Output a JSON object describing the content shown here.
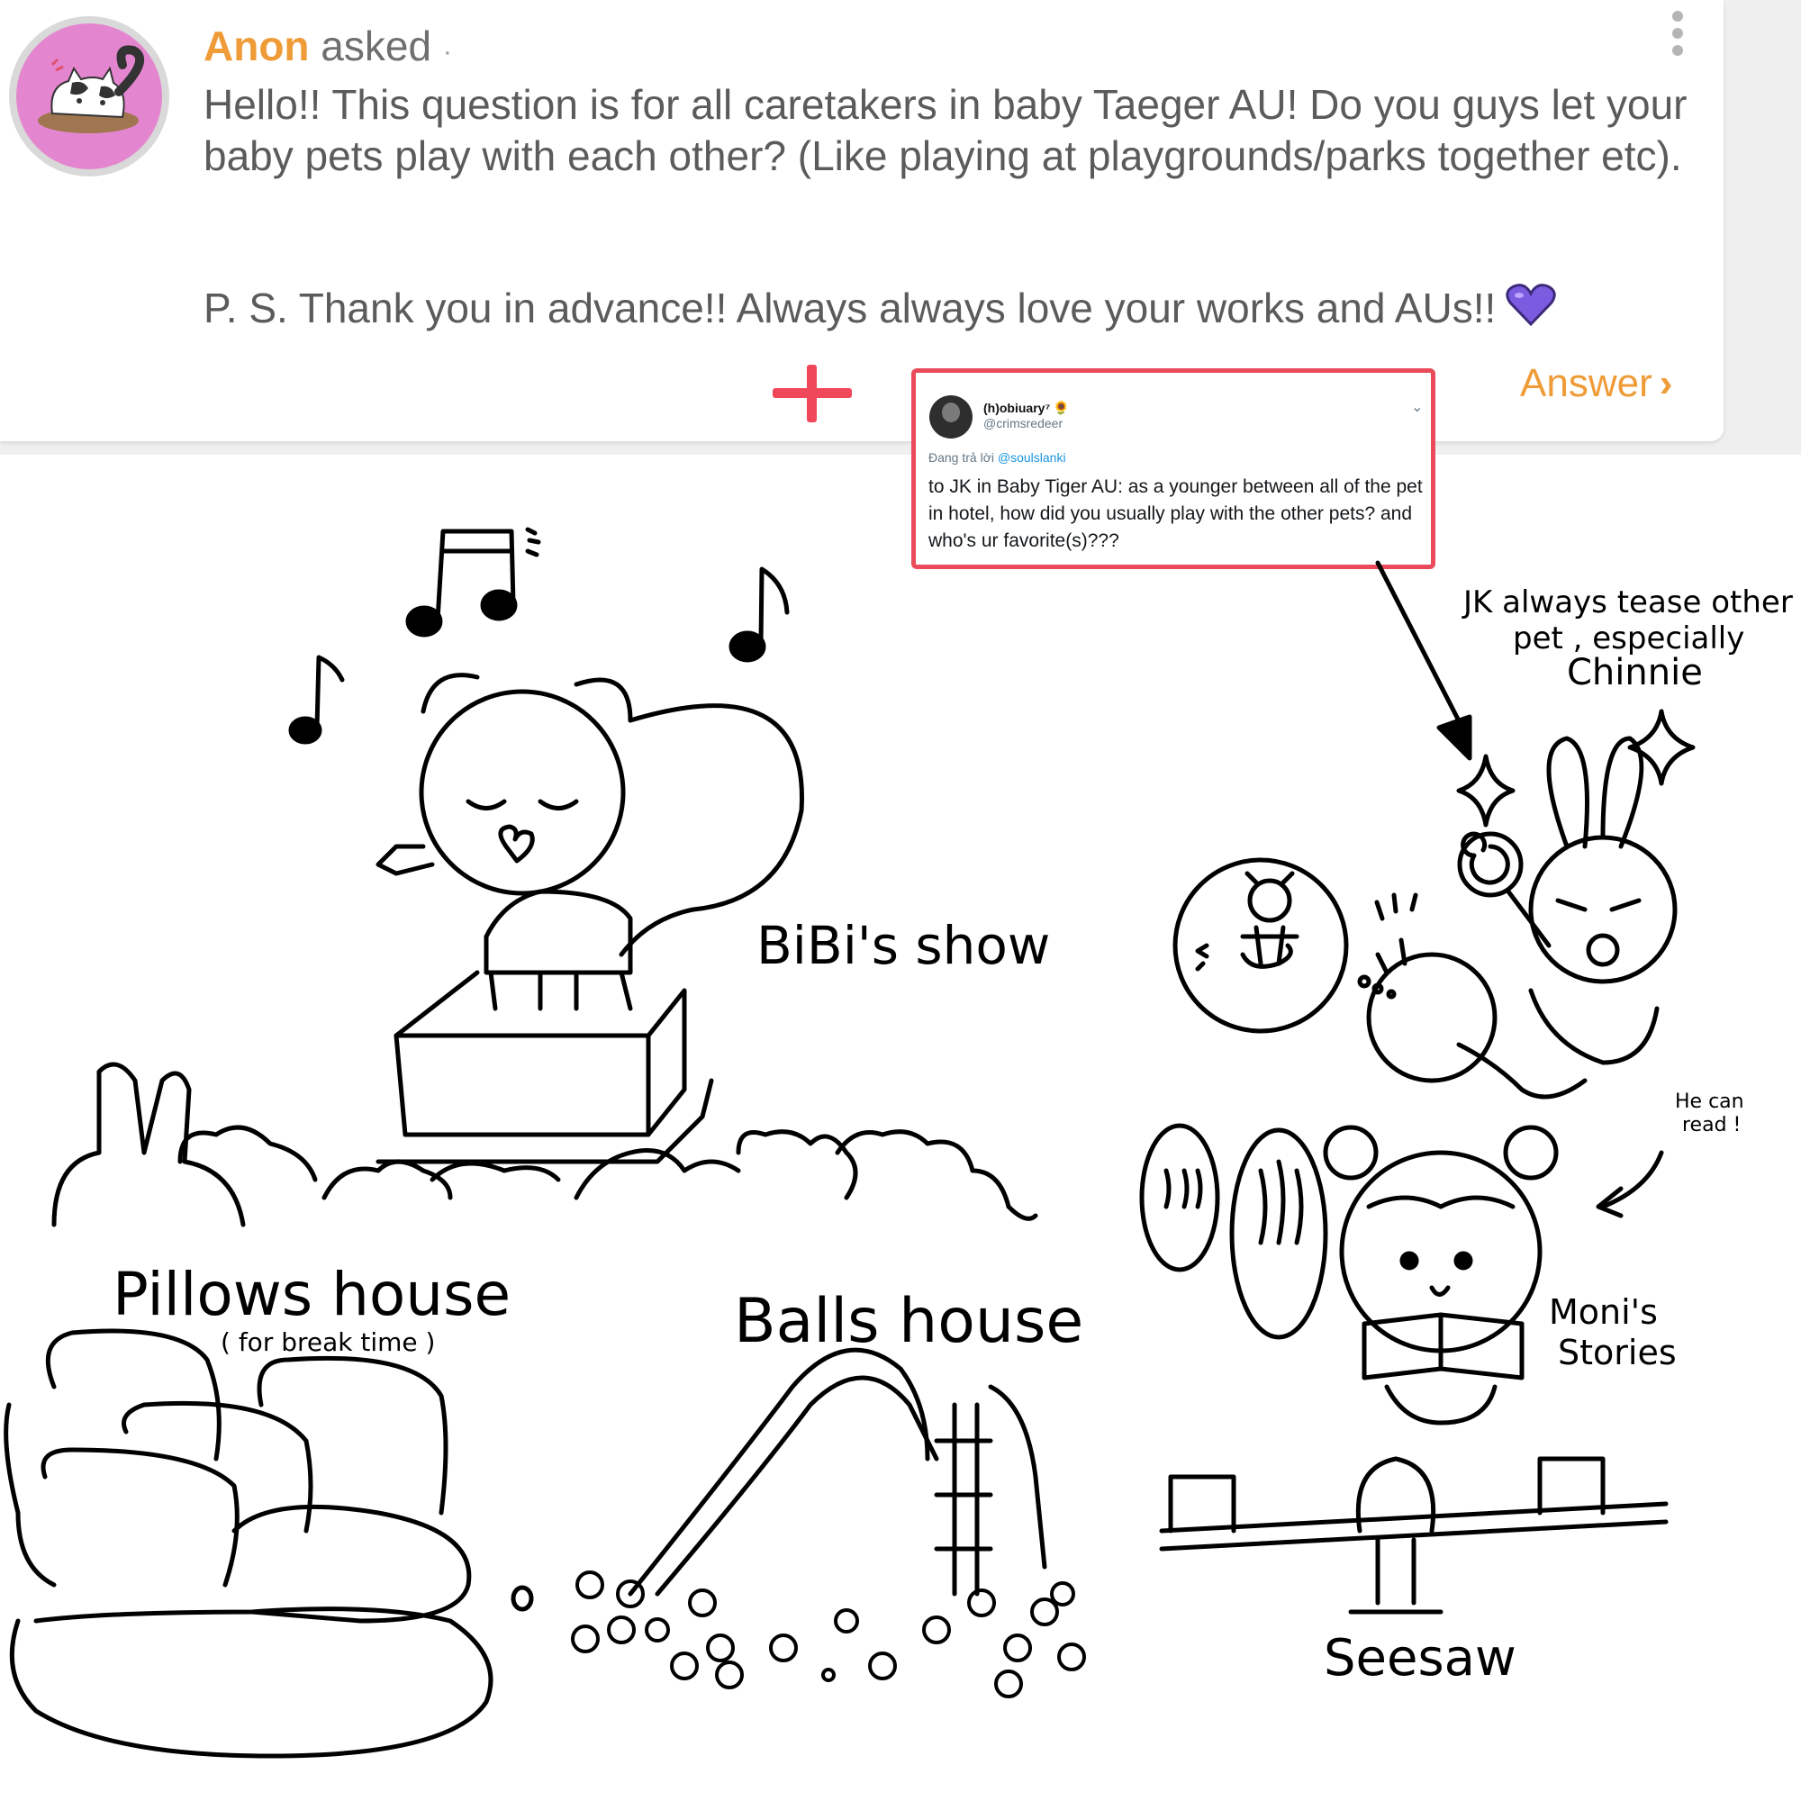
{
  "asker": {
    "name": "Anon",
    "verb": "asked",
    "dot": "·"
  },
  "question": {
    "text": "Hello!! This question is for all caretakers in baby Taeger AU! Do you guys let your baby pets play with each other? (Like playing at playgrounds/parks together etc).",
    "ps": "P. S. Thank you in advance!! Always always love your works and AUs!!"
  },
  "actions": {
    "answer_label": "Answer",
    "answer_chevron": "›",
    "more_icon": "kebab-menu-icon"
  },
  "tweet": {
    "display_name": "(h)obiuary⁷",
    "badge": "🌻",
    "handle": "@crimsredeer",
    "reply_prefix": "Đang trả lời",
    "reply_to": "@soulslanki",
    "body": "to JK in Baby Tiger AU: as a younger between all of the pet in hotel, how did you usually play with the other pets? and who's ur favorite(s)???",
    "chevron": "⌄"
  },
  "drawing": {
    "labels": {
      "bibi_show": "BiBi's show",
      "jk_note_1": "JK always tease other",
      "jk_note_2": "pet , especially",
      "jk_note_3": "Chinnie",
      "he_can_read_1": "He can",
      "he_can_read_2": "read !",
      "moni_1": "Moni's",
      "moni_2": "Stories",
      "pillows_house": "Pillows house",
      "pillows_sub": "( for break time )",
      "balls_house": "Balls house",
      "seesaw": "Seesaw"
    }
  },
  "colors": {
    "accent_orange": "#ef9b37",
    "highlight_red": "#ea4b5b",
    "heart_purple": "#7b5ce0",
    "avatar_pink": "#e486cf"
  }
}
